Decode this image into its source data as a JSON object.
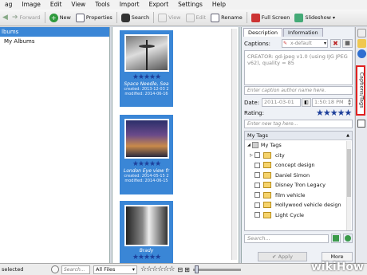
{
  "menubar": [
    "ag",
    "Image",
    "Edit",
    "View",
    "Tools",
    "Import",
    "Export",
    "Settings",
    "Help"
  ],
  "toolbar": {
    "forward": "Forward",
    "new": "New",
    "properties": "Properties",
    "search": "Search",
    "view": "View",
    "edit": "Edit",
    "rename": "Rename",
    "fullscreen": "Full Screen",
    "slideshow": "Slideshow"
  },
  "left_panel": {
    "rows": [
      "lbums",
      "My Albums"
    ]
  },
  "thumbnails": [
    {
      "caption": "Space Needle, Sea",
      "created": "created: 2013-12-03 2",
      "modified": "modified: 2014-06-16"
    },
    {
      "caption": "London Eye view fr",
      "created": "created: 2014-05-15 2",
      "modified": "modified: 2014-06-15"
    },
    {
      "caption": "Brady",
      "created": "",
      "modified": ""
    }
  ],
  "right_panel": {
    "tab_description": "Description",
    "tab_information": "Information",
    "captions_label": "Captions:",
    "captions_default": "x-default",
    "caption_text": "CREATOR: gd-jpeg v1.0 (using IJG JPEG v62), quality = 85",
    "author_placeholder": "Enter caption author name here.",
    "date_label": "Date:",
    "date_value": "2011-03-01",
    "time_value": "1:50:18 PM",
    "rating_label": "Rating:",
    "new_tag_placeholder": "Enter new tag here...",
    "tags_header": "My Tags",
    "tags_root": "My Tags",
    "tags": [
      "city",
      "concept design",
      "Daniel Simon",
      "Disney Tron Legacy",
      "film vehicle",
      "Hollywood vehicle design",
      "Light Cycle"
    ],
    "search_placeholder": "Search...",
    "apply_label": "Apply",
    "more_label": "More"
  },
  "side_strip": {
    "captions_tab": "Captions/Tags"
  },
  "statusbar": {
    "selected": "selected",
    "search_placeholder": "Search...",
    "filter_value": "All Files"
  },
  "watermark": "wikiHow",
  "colors": {
    "selection": "#3a86d6",
    "stars": "#1d3f9a",
    "highlight_border": "#e02020"
  }
}
